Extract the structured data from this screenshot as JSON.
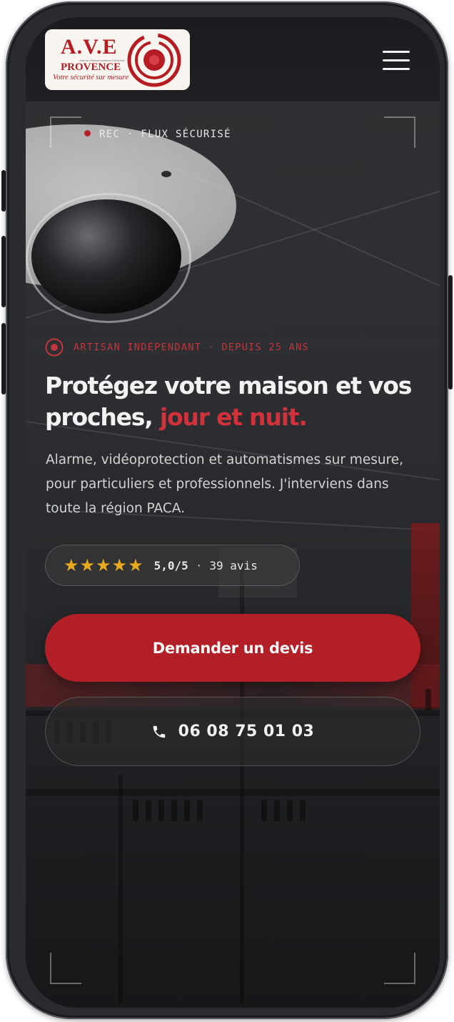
{
  "header": {
    "logo": {
      "name": "A.V.E",
      "small_text": "Alarme Vidéosurveillance Electricité",
      "region": "PROVENCE",
      "tagline": "Votre sécurité sur mesure"
    },
    "menu_icon": "hamburger-menu-icon"
  },
  "camera_overlay": {
    "status": "REC · FLUX SÉCURISÉ",
    "status_dot_color": "#b5232a"
  },
  "hero": {
    "eyebrow": "ARTISAN INDÉPENDANT · DEPUIS 25 ANS",
    "eyebrow_icon": "target-icon",
    "headline_plain": "Protégez votre maison et vos proches, ",
    "headline_accent": "jour et nuit.",
    "subtitle": "Alarme, vidéoprotection et automatismes sur mesure, pour particuliers et professionnels. J'interviens dans toute la région PACA."
  },
  "rating": {
    "stars": "★★★★★",
    "stars_value": 5,
    "score": "5,0/5",
    "separator": "·",
    "reviews": "39 avis"
  },
  "cta": {
    "quote_label": "Demander un devis",
    "phone_icon": "phone-icon",
    "phone_number": "06 08 75 01 03"
  },
  "colors": {
    "accent_red": "#b21f27",
    "headline_red": "#d1313a",
    "star_gold": "#e7a91e",
    "background": "#1b1c1f"
  }
}
